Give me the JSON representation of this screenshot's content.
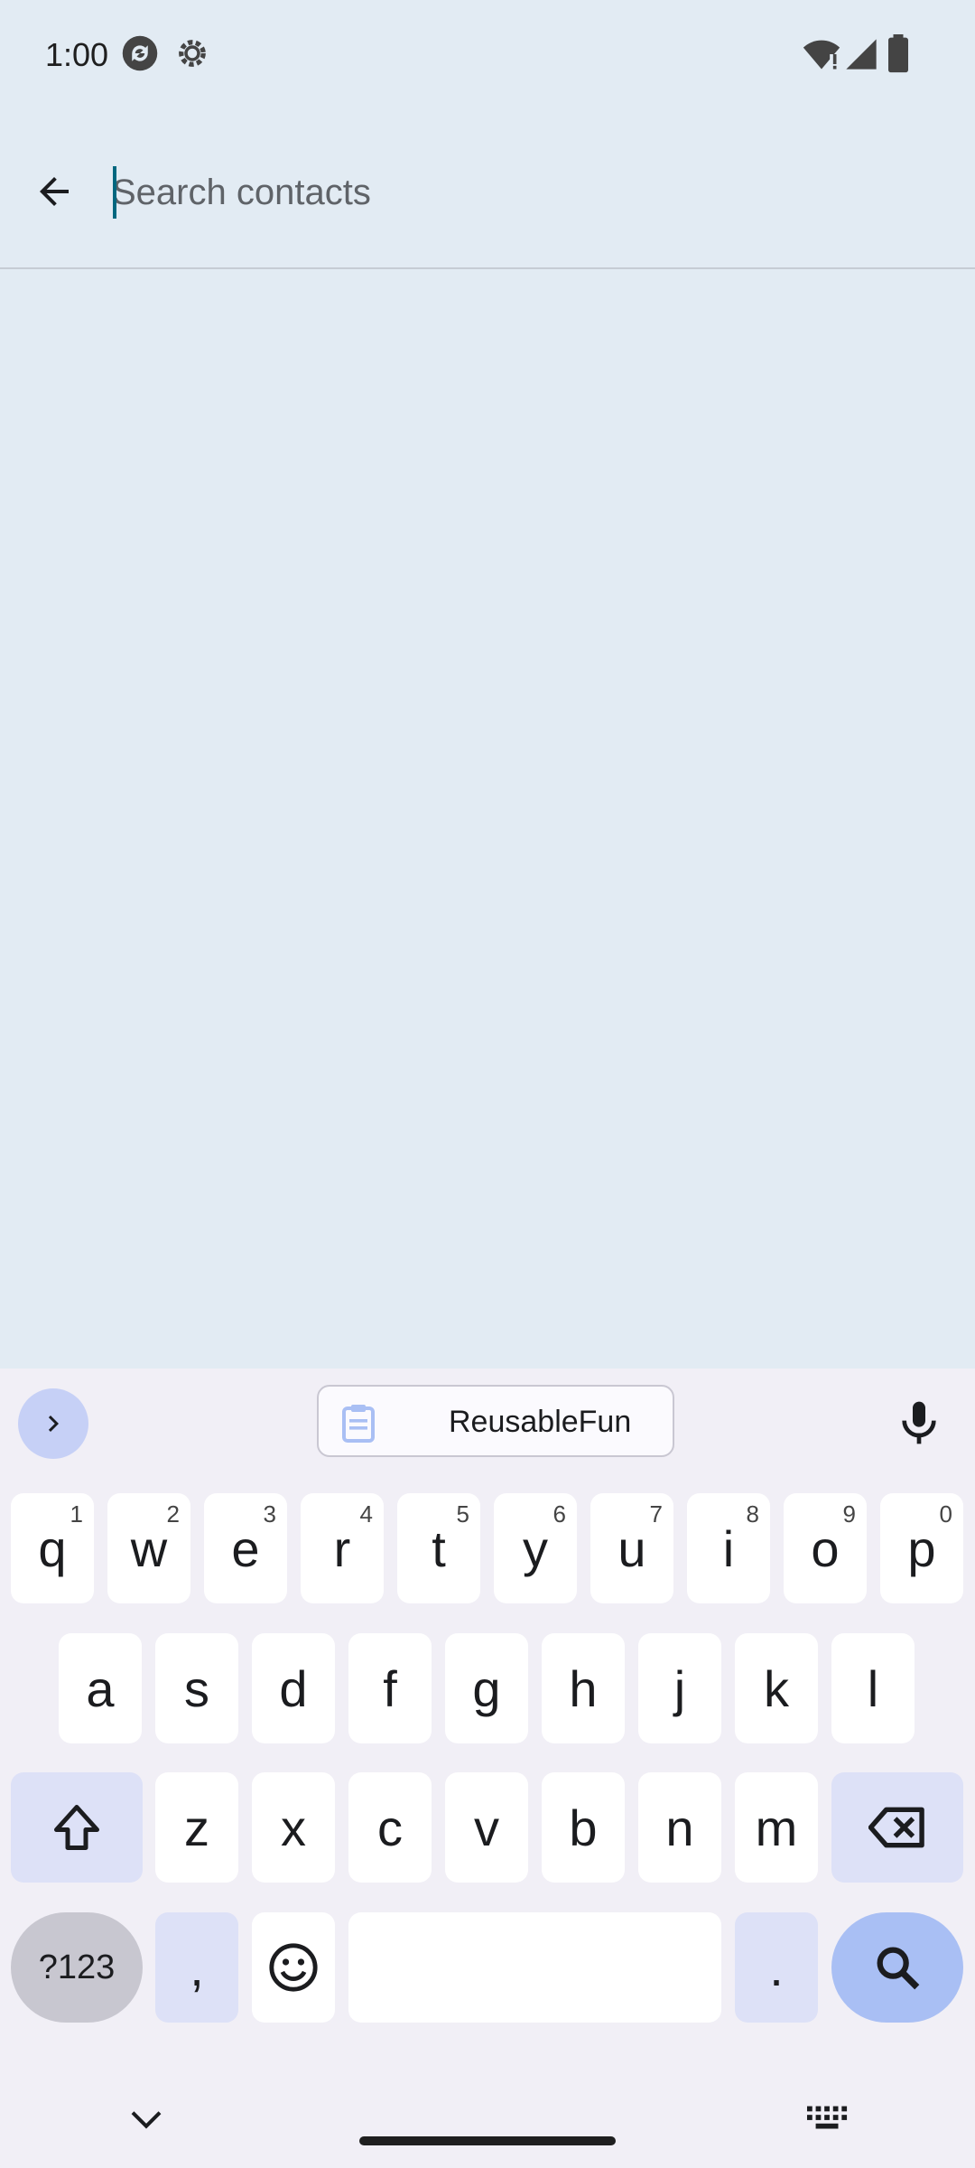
{
  "status_bar": {
    "time": "1:00",
    "icons": [
      "sync-icon",
      "settings-gear-icon",
      "wifi-alert-icon",
      "cell-signal-icon",
      "battery-icon"
    ]
  },
  "search": {
    "placeholder": "Search contacts",
    "value": ""
  },
  "keyboard": {
    "clipboard_chip": "ReusableFun",
    "row1": [
      {
        "key": "q",
        "hint": "1"
      },
      {
        "key": "w",
        "hint": "2"
      },
      {
        "key": "e",
        "hint": "3"
      },
      {
        "key": "r",
        "hint": "4"
      },
      {
        "key": "t",
        "hint": "5"
      },
      {
        "key": "y",
        "hint": "6"
      },
      {
        "key": "u",
        "hint": "7"
      },
      {
        "key": "i",
        "hint": "8"
      },
      {
        "key": "o",
        "hint": "9"
      },
      {
        "key": "p",
        "hint": "0"
      }
    ],
    "row2": [
      "a",
      "s",
      "d",
      "f",
      "g",
      "h",
      "j",
      "k",
      "l"
    ],
    "row3": [
      "z",
      "x",
      "c",
      "v",
      "b",
      "n",
      "m"
    ],
    "symbols_key": "?123",
    "comma_key": ",",
    "period_key": ".",
    "colors": {
      "accent": "#a9bff4",
      "function_key": "#dde1f7",
      "background": "#e2ebf3"
    }
  }
}
